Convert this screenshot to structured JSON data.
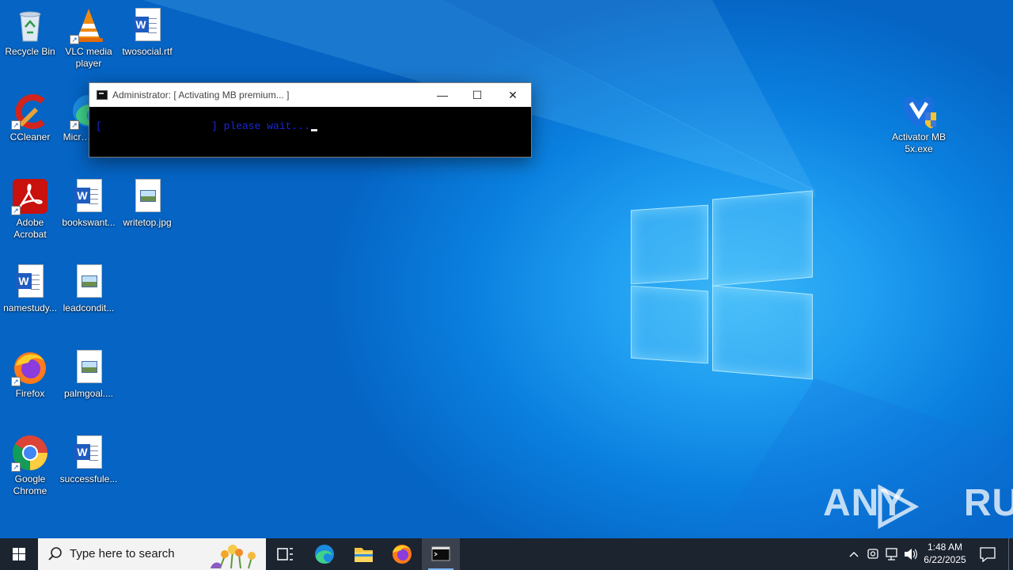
{
  "desktop": {
    "icons": [
      {
        "label": "Recycle Bin",
        "icon": "recycle-bin-icon"
      },
      {
        "label": "VLC media player",
        "icon": "vlc-icon"
      },
      {
        "label": "twosocial.rtf",
        "icon": "word-doc-icon"
      },
      {
        "label": "CCleaner",
        "icon": "ccleaner-icon"
      },
      {
        "label": "Micr… Ed…",
        "icon": "edge-icon"
      },
      {
        "label": "Adobe Acrobat",
        "icon": "acrobat-icon"
      },
      {
        "label": "bookswant...",
        "icon": "word-doc-icon"
      },
      {
        "label": "writetop.jpg",
        "icon": "image-file-icon"
      },
      {
        "label": "namestudy...",
        "icon": "word-doc-icon"
      },
      {
        "label": "leadcondit...",
        "icon": "image-file-icon"
      },
      {
        "label": "Firefox",
        "icon": "firefox-icon"
      },
      {
        "label": "palmgoal....",
        "icon": "image-file-icon"
      },
      {
        "label": "Google Chrome",
        "icon": "chrome-icon"
      },
      {
        "label": "successfule...",
        "icon": "word-doc-icon"
      },
      {
        "label": "Activator MB 5x.exe",
        "icon": "malwarebytes-icon"
      }
    ]
  },
  "console": {
    "title": "Administrator:  [ Activating MB premium... ]",
    "bracket": "[",
    "output": "] please wait...",
    "minimize": "—",
    "maximize": "☐",
    "close": "✕"
  },
  "watermark": {
    "left": "ANY",
    "right": "RUN"
  },
  "taskbar": {
    "search_placeholder": "Type here to search",
    "time": "1:48 AM",
    "date": "6/22/2025"
  }
}
